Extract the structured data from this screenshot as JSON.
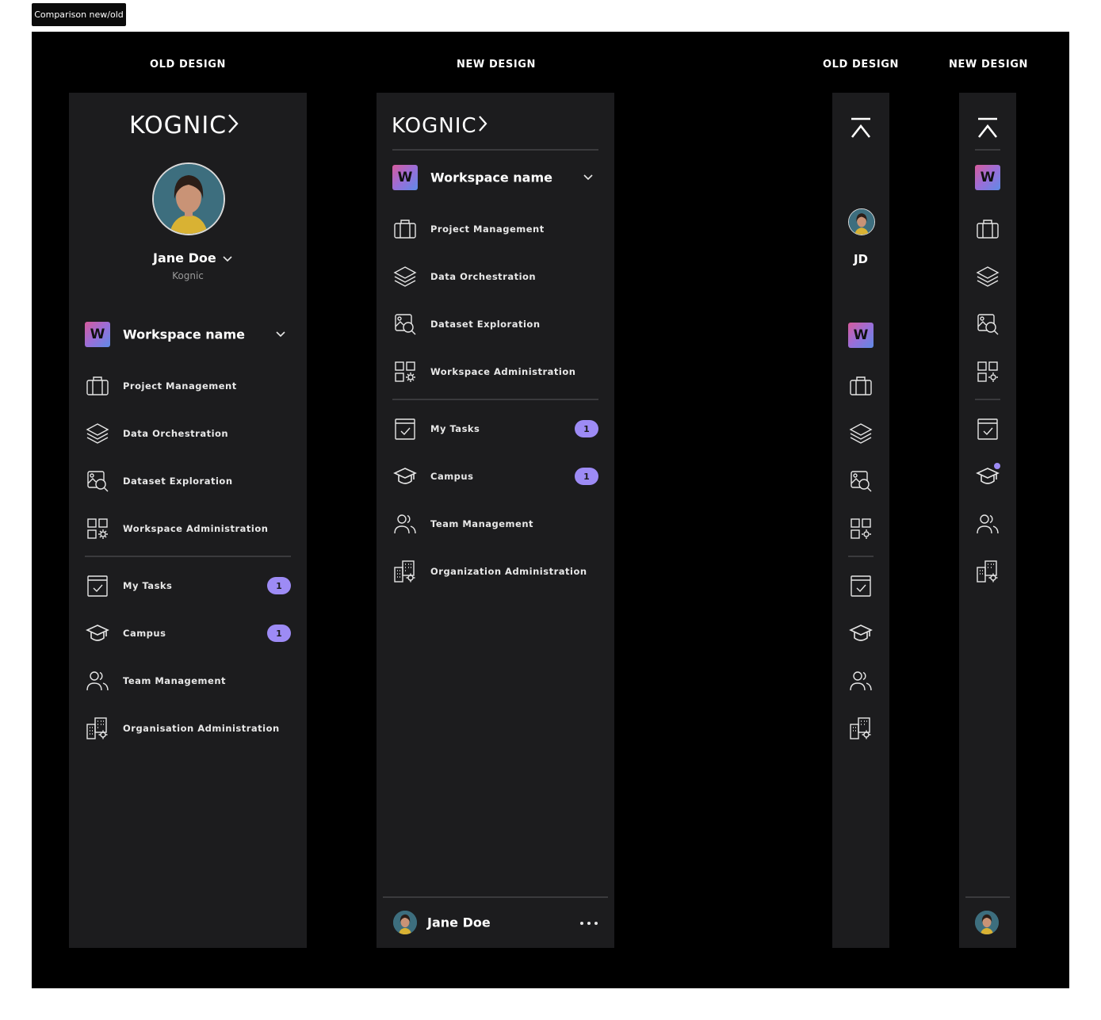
{
  "frame_label": "Comparison new/old",
  "headings": {
    "old_full": "OLD DESIGN",
    "new_full": "NEW DESIGN",
    "old_compact": "OLD DESIGN",
    "new_compact": "NEW DESIGN"
  },
  "brand": {
    "logo_text": "KOGNIC",
    "logo_icon": "kognic-chevron-icon",
    "accent": "#9d8bf5"
  },
  "user": {
    "name": "Jane Doe",
    "org": "Kognic",
    "initials": "JD"
  },
  "workspace": {
    "badge": "W",
    "name": "Workspace name"
  },
  "old_nav": {
    "workspace_items": [
      {
        "label": "Project Management",
        "icon": "briefcase-icon"
      },
      {
        "label": "Data Orchestration",
        "icon": "layers-icon"
      },
      {
        "label": "Dataset Exploration",
        "icon": "image-search-icon"
      },
      {
        "label": "Workspace Administration",
        "icon": "grid-settings-icon"
      }
    ],
    "global_items": [
      {
        "label": "My Tasks",
        "icon": "task-checkbox-icon",
        "badge": "1"
      },
      {
        "label": "Campus",
        "icon": "graduation-cap-icon",
        "badge": "1"
      },
      {
        "label": "Team Management",
        "icon": "users-icon"
      },
      {
        "label": "Organisation Administration",
        "icon": "building-settings-icon"
      }
    ]
  },
  "new_nav": {
    "workspace_items": [
      {
        "label": "Project Management",
        "icon": "briefcase-icon"
      },
      {
        "label": "Data Orchestration",
        "icon": "layers-icon"
      },
      {
        "label": "Dataset Exploration",
        "icon": "image-search-icon"
      },
      {
        "label": "Workspace Administration",
        "icon": "grid-settings-icon"
      }
    ],
    "global_items": [
      {
        "label": "My Tasks",
        "icon": "task-checkbox-icon",
        "badge": "1"
      },
      {
        "label": "Campus",
        "icon": "graduation-cap-icon",
        "badge": "1"
      },
      {
        "label": "Team Management",
        "icon": "users-icon"
      },
      {
        "label": "Organization Administration",
        "icon": "building-settings-icon"
      }
    ],
    "footer": {
      "user_name": "Jane Doe",
      "more_icon": "more-horizontal-icon"
    }
  }
}
